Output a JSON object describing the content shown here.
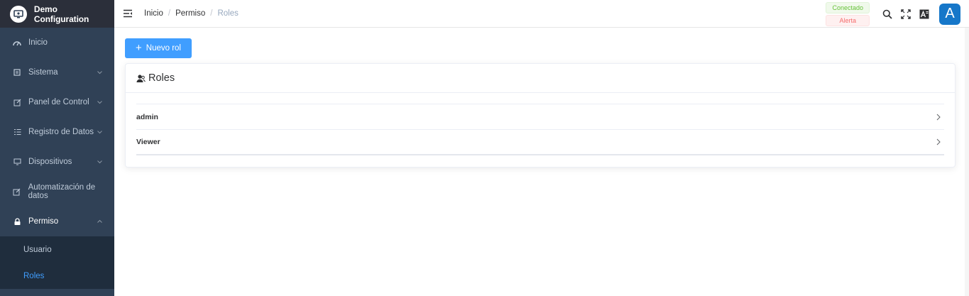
{
  "app": {
    "title": "Demo Configuration"
  },
  "sidebar": {
    "items": [
      {
        "label": "Inicio",
        "icon": "dashboard-icon"
      },
      {
        "label": "Sistema",
        "icon": "system-icon",
        "expandable": true
      },
      {
        "label": "Panel de Control",
        "icon": "edit-icon",
        "expandable": true
      },
      {
        "label": "Registro de Datos",
        "icon": "list-icon",
        "expandable": true
      },
      {
        "label": "Dispositivos",
        "icon": "device-icon",
        "expandable": true
      },
      {
        "label": "Automatización de datos",
        "icon": "edit-icon"
      },
      {
        "label": "Permiso",
        "icon": "lock-icon",
        "expandable": true,
        "open": true
      }
    ],
    "submenu": [
      {
        "label": "Usuario"
      },
      {
        "label": "Roles",
        "active": true
      }
    ]
  },
  "header": {
    "breadcrumb": [
      "Inicio",
      "Permiso",
      "Roles"
    ],
    "breadcrumb_sep": "/",
    "status_connected": "Conectado",
    "status_alert": "Alerta",
    "avatar_letter": "A"
  },
  "main": {
    "new_button": "Nuevo rol",
    "card_title": "Roles",
    "roles": [
      "admin",
      "Viewer"
    ]
  },
  "colors": {
    "sidebar_bg": "#304156",
    "primary": "#409eff",
    "avatar": "#1677c9"
  }
}
